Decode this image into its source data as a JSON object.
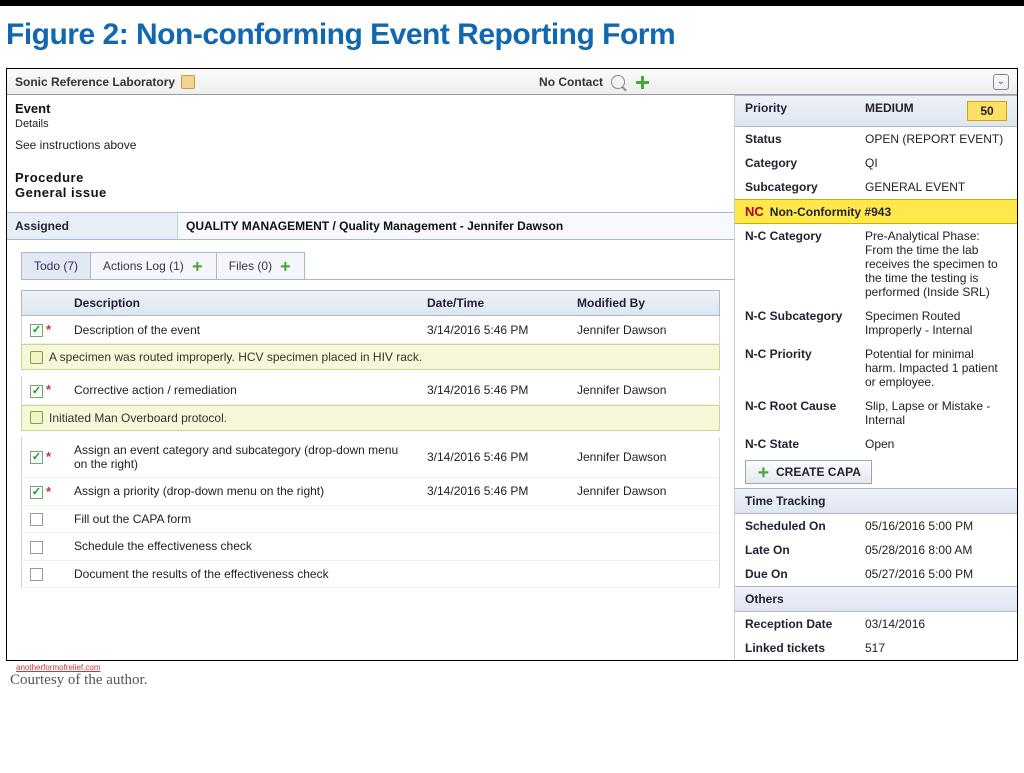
{
  "figure": {
    "title": "Figure 2: Non-conforming Event Reporting Form"
  },
  "header": {
    "lab_name": "Sonic Reference Laboratory",
    "contact_label": "No Contact"
  },
  "event": {
    "title": "Event",
    "details_label": "Details",
    "details_text": "See instructions above",
    "procedure_label": "Procedure",
    "procedure_sub": "General issue"
  },
  "assigned": {
    "label": "Assigned",
    "value": "QUALITY MANAGEMENT / Quality Management - Jennifer Dawson"
  },
  "tabs": [
    {
      "label": "Todo (7)"
    },
    {
      "label": "Actions Log (1)"
    },
    {
      "label": "Files (0)"
    }
  ],
  "task_columns": {
    "description": "Description",
    "datetime": "Date/Time",
    "modified_by": "Modified By"
  },
  "tasks": [
    {
      "checked": true,
      "required": true,
      "description": "Description of the event",
      "datetime": "3/14/2016 5:46 PM",
      "modified_by": "Jennifer Dawson"
    },
    {
      "note": "A specimen was routed improperly. HCV specimen placed in HIV rack."
    },
    {
      "checked": true,
      "required": true,
      "description": "Corrective action / remediation",
      "datetime": "3/14/2016 5:46 PM",
      "modified_by": "Jennifer Dawson"
    },
    {
      "note": "Initiated Man Overboard protocol."
    },
    {
      "checked": true,
      "required": true,
      "description": "Assign an event category and subcategory (drop-down menu on the right)",
      "datetime": "3/14/2016 5:46 PM",
      "modified_by": "Jennifer Dawson"
    },
    {
      "checked": true,
      "required": true,
      "description": "Assign a priority (drop-down menu on the right)",
      "datetime": "3/14/2016 5:46 PM",
      "modified_by": "Jennifer Dawson"
    },
    {
      "checked": false,
      "required": false,
      "description": "Fill out the CAPA form",
      "datetime": "",
      "modified_by": ""
    },
    {
      "checked": false,
      "required": false,
      "description": "Schedule the effectiveness check",
      "datetime": "",
      "modified_by": ""
    },
    {
      "checked": false,
      "required": false,
      "description": "Document the results of the effectiveness check",
      "datetime": "",
      "modified_by": ""
    }
  ],
  "right": {
    "priority_label": "Priority",
    "priority_value": "MEDIUM",
    "priority_number": "50",
    "status_label": "Status",
    "status_value": "OPEN (REPORT EVENT)",
    "category_label": "Category",
    "category_value": "QI",
    "subcategory_label": "Subcategory",
    "subcategory_value": "GENERAL EVENT",
    "nc_badge": "NC",
    "nc_title": "Non-Conformity #943",
    "nc_category_label": "N-C Category",
    "nc_category_value": "Pre-Analytical Phase: From the time the lab receives the specimen to the time the testing is performed (Inside SRL)",
    "nc_subcategory_label": "N-C Subcategory",
    "nc_subcategory_value": "Specimen Routed Improperly - Internal",
    "nc_priority_label": "N-C Priority",
    "nc_priority_value": "Potential for minimal harm. Impacted 1 patient or employee.",
    "nc_rootcause_label": "N-C Root Cause",
    "nc_rootcause_value": "Slip, Lapse or Mistake - Internal",
    "nc_state_label": "N-C State",
    "nc_state_value": "Open",
    "create_capa": "CREATE CAPA",
    "time_tracking_label": "Time Tracking",
    "scheduled_on_label": "Scheduled On",
    "scheduled_on_value": "05/16/2016 5:00 PM",
    "late_on_label": "Late On",
    "late_on_value": "05/28/2016 8:00 AM",
    "due_on_label": "Due On",
    "due_on_value": "05/27/2016 5:00 PM",
    "others_label": "Others",
    "reception_label": "Reception Date",
    "reception_value": "03/14/2016",
    "linked_label": "Linked tickets",
    "linked_value": "517"
  },
  "footer": {
    "credit": "anotherformofrelief.com",
    "caption": "Courtesy of the author."
  }
}
